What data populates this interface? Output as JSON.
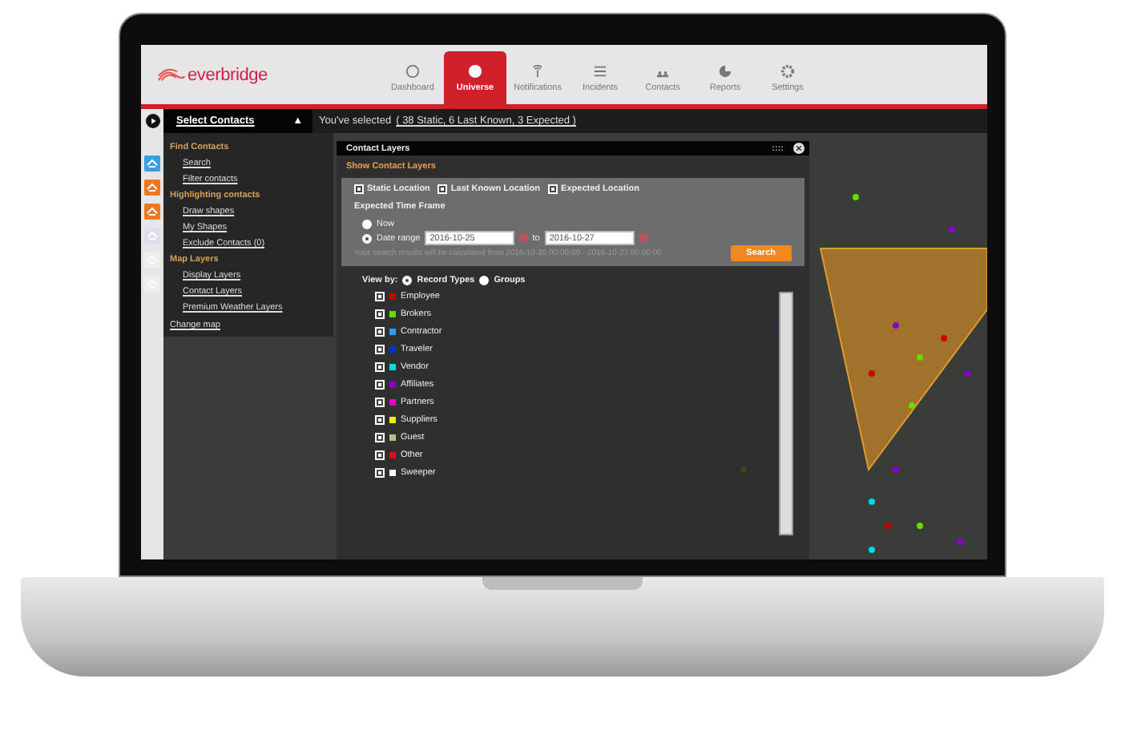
{
  "app": {
    "logo": "everbridge",
    "nav": [
      {
        "label": "Dashboard",
        "selected": false
      },
      {
        "label": "Universe",
        "selected": true
      },
      {
        "label": "Notifications",
        "selected": false
      },
      {
        "label": "Incidents",
        "selected": false
      },
      {
        "label": "Contacts",
        "selected": false
      },
      {
        "label": "Reports",
        "selected": false
      },
      {
        "label": "Settings",
        "selected": false
      }
    ]
  },
  "selection_bar": {
    "title": "Select Contacts",
    "caret": "▲",
    "prefix": "You've selected",
    "summary": "( 38 Static, 6 Last Known, 3 Expected )"
  },
  "side_menu": {
    "sections": [
      {
        "title": "Find Contacts",
        "items": [
          "Search",
          "Filter contacts"
        ]
      },
      {
        "title": "Highlighting contacts",
        "items": [
          "Draw shapes",
          "My Shapes",
          "Exclude Contacts (0)"
        ]
      },
      {
        "title": "Map Layers",
        "items": [
          "Display Layers",
          "Contact Layers",
          "Premium Weather Layers"
        ]
      }
    ],
    "footer": "Change map"
  },
  "dialog": {
    "title": "Contact Layers",
    "handle": "::::",
    "section": "Show Contact Layers",
    "layers": [
      {
        "label": "Static Location",
        "checked": true
      },
      {
        "label": "Last Known Location",
        "checked": true
      },
      {
        "label": "Expected Location",
        "checked": true
      }
    ],
    "time_frame": {
      "title": "Expected Time Frame",
      "options": [
        {
          "label": "Now",
          "selected": false
        },
        {
          "label": "Date range",
          "selected": true
        }
      ],
      "from": "2016-10-25",
      "to_label": "to",
      "to": "2016-10-27",
      "note": "Your search results will be calculated from 2016-10-25 00:00:00 - 2016-10-27 00:00:00",
      "search_button": "Search"
    },
    "view_by": {
      "label": "View by:",
      "options": [
        {
          "label": "Record Types",
          "selected": true
        },
        {
          "label": "Groups",
          "selected": false
        }
      ]
    },
    "record_types": [
      {
        "label": "Employee",
        "checked": true,
        "color": "#cc0000"
      },
      {
        "label": "Brokers",
        "checked": true,
        "color": "#66dd00"
      },
      {
        "label": "Contractor",
        "checked": true,
        "color": "#3399ee"
      },
      {
        "label": "Traveler",
        "checked": true,
        "color": "#0033cc"
      },
      {
        "label": "Vendor",
        "checked": true,
        "color": "#00dddd"
      },
      {
        "label": "Affiliates",
        "checked": true,
        "color": "#8800cc"
      },
      {
        "label": "Partners",
        "checked": true,
        "color": "#ee00cc"
      },
      {
        "label": "Suppliers",
        "checked": true,
        "color": "#eeee00"
      },
      {
        "label": "Guest",
        "checked": true,
        "color": "#bbbb88"
      },
      {
        "label": "Other",
        "checked": true,
        "color": "#ee0022"
      },
      {
        "label": "Sweeper",
        "checked": true,
        "color": "#ffffff"
      }
    ]
  }
}
